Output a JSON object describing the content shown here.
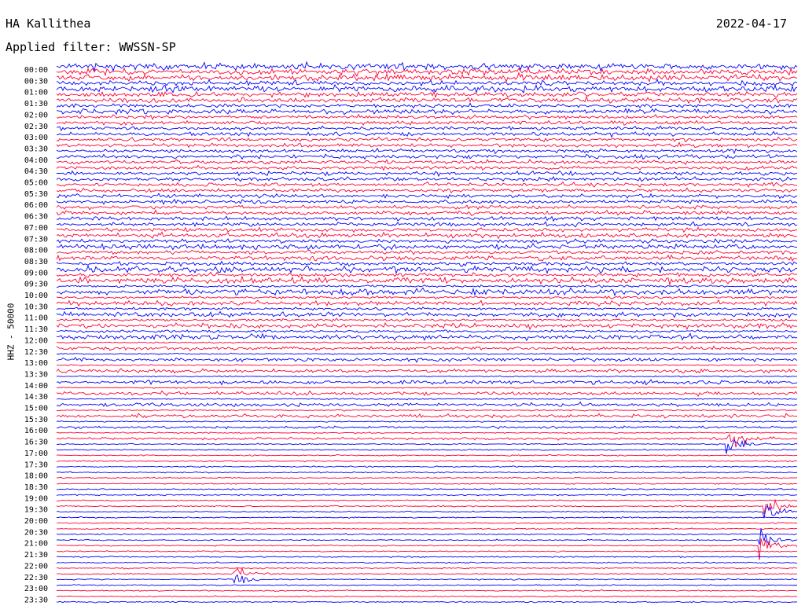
{
  "header": {
    "station": "HA Kallithea",
    "date": "2022-04-17",
    "filter": "Applied filter: WWSSN-SP"
  },
  "channel_label": "HHZ - 50000",
  "colors": {
    "trace_a": "#0000ff",
    "trace_b": "#ff0033",
    "background": "#ffffff"
  },
  "chart_data": {
    "type": "line",
    "title": "HA Kallithea",
    "subtitle": "Applied filter: WWSSN-SP",
    "ylabel": "HHZ - 50000",
    "xlabel": "",
    "grid": false,
    "legend": "none",
    "trace_minutes": 15,
    "categories": [
      "00:00",
      "00:30",
      "01:00",
      "01:30",
      "02:00",
      "02:30",
      "03:00",
      "03:30",
      "04:00",
      "04:30",
      "05:00",
      "05:30",
      "06:00",
      "06:30",
      "07:00",
      "07:30",
      "08:00",
      "08:30",
      "09:00",
      "09:30",
      "10:00",
      "10:30",
      "11:00",
      "11:30",
      "12:00",
      "12:30",
      "13:00",
      "13:30",
      "14:00",
      "14:30",
      "15:00",
      "15:30",
      "16:00",
      "16:30",
      "17:00",
      "17:30",
      "18:00",
      "18:30",
      "19:00",
      "19:30",
      "20:00",
      "20:30",
      "21:00",
      "21:30",
      "22:00",
      "22:30",
      "23:00",
      "23:30"
    ],
    "series": [
      {
        "values": [
          5,
          5,
          5,
          4,
          4,
          3,
          3,
          3,
          3,
          3,
          3,
          3,
          3,
          3,
          3,
          4,
          4,
          4,
          5,
          5,
          5,
          4,
          4,
          4,
          4,
          3,
          3,
          3,
          3,
          3,
          3,
          3,
          2,
          2,
          1,
          1,
          1,
          1,
          1,
          1,
          1,
          1,
          1,
          1,
          1,
          1,
          1,
          1
        ]
      },
      {
        "values": [
          5,
          4,
          4,
          3,
          3,
          3,
          3,
          3,
          3,
          3,
          3,
          3,
          3,
          3,
          3,
          3,
          3,
          3,
          3,
          2,
          2,
          2,
          2,
          2,
          1,
          1,
          1,
          1,
          1,
          1,
          1,
          1,
          1,
          1,
          1,
          1,
          1,
          1,
          1,
          1,
          1,
          1,
          1,
          1,
          1,
          1,
          1,
          1
        ]
      }
    ],
    "events": [
      {
        "time": "16:30",
        "x_frac": 0.905,
        "amplitude": 6
      },
      {
        "time": "19:30",
        "x_frac": 0.955,
        "amplitude": 6
      },
      {
        "time": "21:00",
        "x_frac": 0.95,
        "amplitude": 5
      },
      {
        "time": "22:30",
        "x_frac": 0.24,
        "amplitude": 4
      }
    ]
  }
}
